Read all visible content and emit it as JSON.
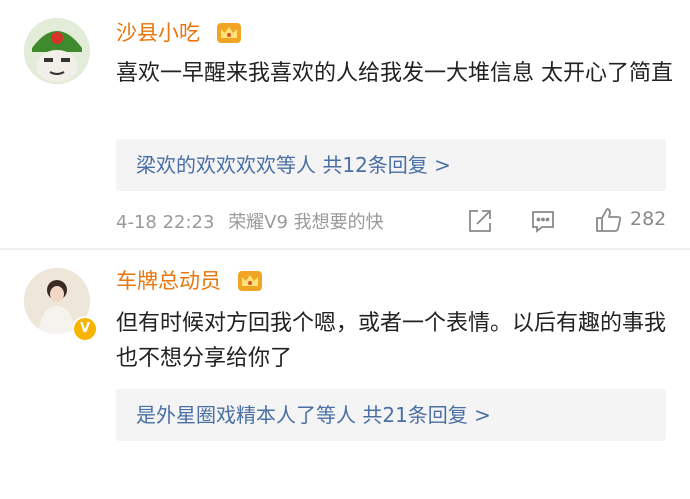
{
  "comments": [
    {
      "username": "沙县小吃",
      "content": "喜欢一早醒来我喜欢的人给我发一大堆信息 太开心了简直",
      "replies_summary": "梁欢的欢欢欢欢等人  共12条回复 >",
      "date": "4-18 22:23",
      "device": "荣耀V9 我想要的快",
      "likes": "282"
    },
    {
      "username": "车牌总动员",
      "content": "但有时候对方回我个嗯，或者一个表情。以后有趣的事我也不想分享给你了",
      "replies_summary": "是外星圈戏精本人了等人  共21条回复 >",
      "badge": "V"
    }
  ],
  "colors": {
    "username": "#e8760c",
    "reply_link": "#4a6fa5",
    "reply_bg": "#f4f4f4",
    "meta": "#9a9a9a"
  }
}
